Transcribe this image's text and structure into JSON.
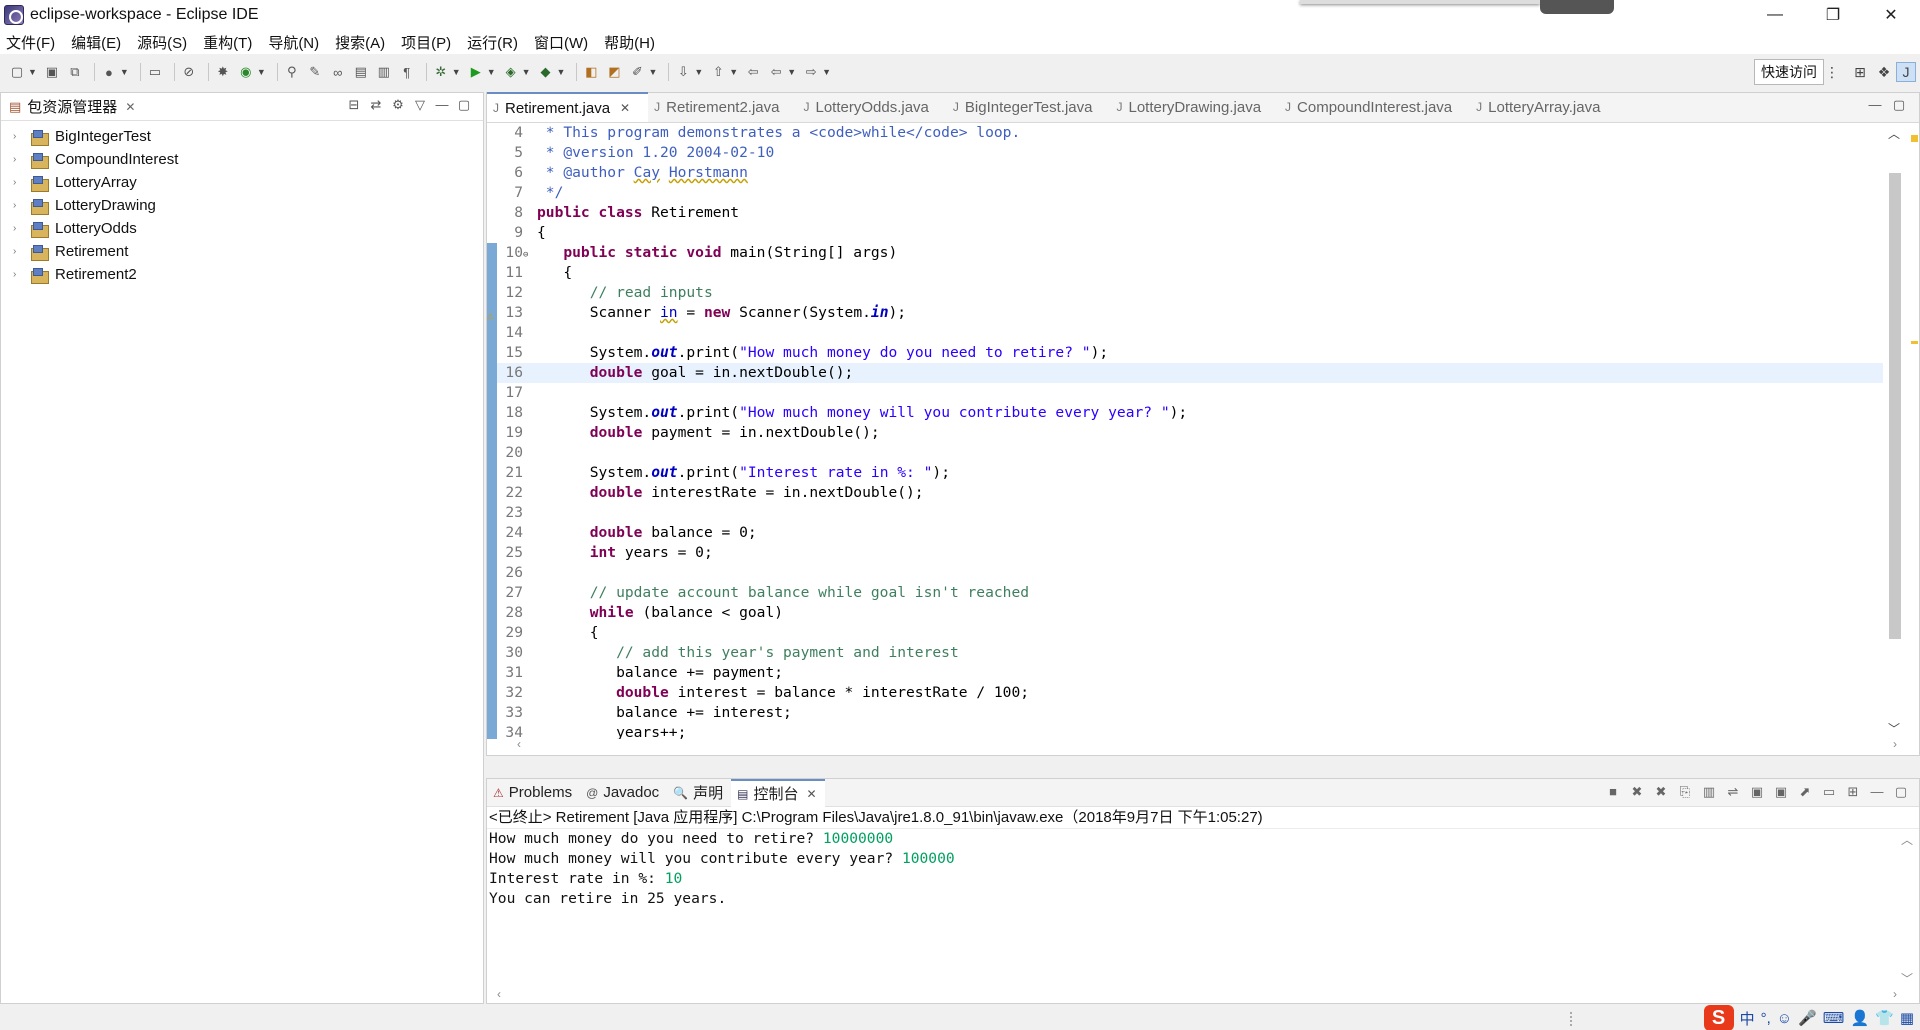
{
  "window": {
    "title": "eclipse-workspace - Eclipse IDE",
    "controls": {
      "minimize": "—",
      "maximize": "❐",
      "close": "✕"
    }
  },
  "menu": [
    "文件(F)",
    "编辑(E)",
    "源码(S)",
    "重构(T)",
    "导航(N)",
    "搜索(A)",
    "项目(P)",
    "运行(R)",
    "窗口(W)",
    "帮助(H)"
  ],
  "toolbar": {
    "quick_access": "快速访问"
  },
  "explorer": {
    "title": "包资源管理器",
    "projects": [
      "BigIntegerTest",
      "CompoundInterest",
      "LotteryArray",
      "LotteryDrawing",
      "LotteryOdds",
      "Retirement",
      "Retirement2"
    ]
  },
  "editor": {
    "tabs": [
      "Retirement.java",
      "Retirement2.java",
      "LotteryOdds.java",
      "BigIntegerTest.java",
      "LotteryDrawing.java",
      "CompoundInterest.java",
      "LotteryArray.java"
    ],
    "active_tab": 0,
    "highlight_line": 16,
    "lines": [
      {
        "n": 4,
        "parts": [
          [
            "jd",
            " * This program demonstrates a <code>while</code> loop."
          ]
        ]
      },
      {
        "n": 5,
        "parts": [
          [
            "jd",
            " * @version 1.20 2004-02-10"
          ]
        ]
      },
      {
        "n": 6,
        "parts": [
          [
            "jd",
            " * @author "
          ],
          [
            "jdu",
            "Cay"
          ],
          [
            "jd",
            " "
          ],
          [
            "jdu",
            "Horstmann"
          ]
        ]
      },
      {
        "n": 7,
        "parts": [
          [
            "jd",
            " */"
          ]
        ]
      },
      {
        "n": 8,
        "parts": [
          [
            "kw",
            "public class"
          ],
          [
            "t",
            " Retirement"
          ]
        ]
      },
      {
        "n": 9,
        "parts": [
          [
            "t",
            "{"
          ]
        ]
      },
      {
        "n": 10,
        "fold": true,
        "parts": [
          [
            "t",
            "   "
          ],
          [
            "kw",
            "public static void"
          ],
          [
            "t",
            " main(String[] args)"
          ]
        ]
      },
      {
        "n": 11,
        "parts": [
          [
            "t",
            "   {"
          ]
        ]
      },
      {
        "n": 12,
        "parts": [
          [
            "t",
            "      "
          ],
          [
            "cm",
            "// read inputs"
          ]
        ]
      },
      {
        "n": 13,
        "warn": true,
        "parts": [
          [
            "t",
            "      Scanner "
          ],
          [
            "ul",
            "in"
          ],
          [
            "t",
            " = "
          ],
          [
            "kw",
            "new"
          ],
          [
            "t",
            " Scanner(System."
          ],
          [
            "sf",
            "in"
          ],
          [
            "t",
            ");"
          ]
        ]
      },
      {
        "n": 14,
        "parts": [
          [
            "t",
            ""
          ]
        ]
      },
      {
        "n": 15,
        "parts": [
          [
            "t",
            "      System."
          ],
          [
            "sf",
            "out"
          ],
          [
            "t",
            ".print("
          ],
          [
            "str",
            "\"How much money do you need to retire? \""
          ],
          [
            "t",
            ");"
          ]
        ]
      },
      {
        "n": 16,
        "parts": [
          [
            "t",
            "      "
          ],
          [
            "kw",
            "double"
          ],
          [
            "t",
            " goal = in.nextDouble();"
          ]
        ]
      },
      {
        "n": 17,
        "parts": [
          [
            "t",
            ""
          ]
        ]
      },
      {
        "n": 18,
        "parts": [
          [
            "t",
            "      System."
          ],
          [
            "sf",
            "out"
          ],
          [
            "t",
            ".print("
          ],
          [
            "str",
            "\"How much money will you contribute every year? \""
          ],
          [
            "t",
            ");"
          ]
        ]
      },
      {
        "n": 19,
        "parts": [
          [
            "t",
            "      "
          ],
          [
            "kw",
            "double"
          ],
          [
            "t",
            " payment = in.nextDouble();"
          ]
        ]
      },
      {
        "n": 20,
        "parts": [
          [
            "t",
            ""
          ]
        ]
      },
      {
        "n": 21,
        "parts": [
          [
            "t",
            "      System."
          ],
          [
            "sf",
            "out"
          ],
          [
            "t",
            ".print("
          ],
          [
            "str",
            "\"Interest rate in %: \""
          ],
          [
            "t",
            ");"
          ]
        ]
      },
      {
        "n": 22,
        "parts": [
          [
            "t",
            "      "
          ],
          [
            "kw",
            "double"
          ],
          [
            "t",
            " interestRate = in.nextDouble();"
          ]
        ]
      },
      {
        "n": 23,
        "parts": [
          [
            "t",
            ""
          ]
        ]
      },
      {
        "n": 24,
        "parts": [
          [
            "t",
            "      "
          ],
          [
            "kw",
            "double"
          ],
          [
            "t",
            " balance = 0;"
          ]
        ]
      },
      {
        "n": 25,
        "parts": [
          [
            "t",
            "      "
          ],
          [
            "kw",
            "int"
          ],
          [
            "t",
            " years = 0;"
          ]
        ]
      },
      {
        "n": 26,
        "parts": [
          [
            "t",
            ""
          ]
        ]
      },
      {
        "n": 27,
        "parts": [
          [
            "t",
            "      "
          ],
          [
            "cm",
            "// update account balance while goal isn't reached"
          ]
        ]
      },
      {
        "n": 28,
        "parts": [
          [
            "t",
            "      "
          ],
          [
            "kw",
            "while"
          ],
          [
            "t",
            " (balance < goal)"
          ]
        ]
      },
      {
        "n": 29,
        "parts": [
          [
            "t",
            "      {"
          ]
        ]
      },
      {
        "n": 30,
        "parts": [
          [
            "t",
            "         "
          ],
          [
            "cm",
            "// add this year's payment and interest"
          ]
        ]
      },
      {
        "n": 31,
        "parts": [
          [
            "t",
            "         balance += payment;"
          ]
        ]
      },
      {
        "n": 32,
        "parts": [
          [
            "t",
            "         "
          ],
          [
            "kw",
            "double"
          ],
          [
            "t",
            " interest = balance * interestRate / 100;"
          ]
        ]
      },
      {
        "n": 33,
        "parts": [
          [
            "t",
            "         balance += interest;"
          ]
        ]
      },
      {
        "n": 34,
        "parts": [
          [
            "t",
            "         years++;"
          ]
        ]
      }
    ]
  },
  "console": {
    "tabs": [
      "Problems",
      "Javadoc",
      "声明",
      "控制台"
    ],
    "tab_icons": [
      "⚠",
      "@",
      "🔍",
      "▤"
    ],
    "active_tab": 3,
    "status": "<已终止> Retirement [Java 应用程序] C:\\Program Files\\Java\\jre1.8.0_91\\bin\\javaw.exe（2018年9月7日 下午1:05:27)",
    "output": [
      {
        "text": "How much money do you need to retire? ",
        "input": "10000000"
      },
      {
        "text": "How much money will you contribute every year? ",
        "input": "100000"
      },
      {
        "text": "Interest rate in %: ",
        "input": "10"
      },
      {
        "text": "You can retire in 25 years.",
        "input": ""
      }
    ]
  },
  "ime": {
    "logo": "S",
    "items": [
      "中",
      "°,",
      "☺",
      "🎤",
      "⌨",
      "👤",
      "👕",
      "▦"
    ]
  },
  "colors": {
    "keyword": "#7f0055",
    "comment": "#3f7f5f",
    "javadoc": "#3f5fbf",
    "string": "#2a00ff",
    "static_field": "#0000c0",
    "console_input": "#00a060",
    "current_line": "#e8f2fe"
  }
}
